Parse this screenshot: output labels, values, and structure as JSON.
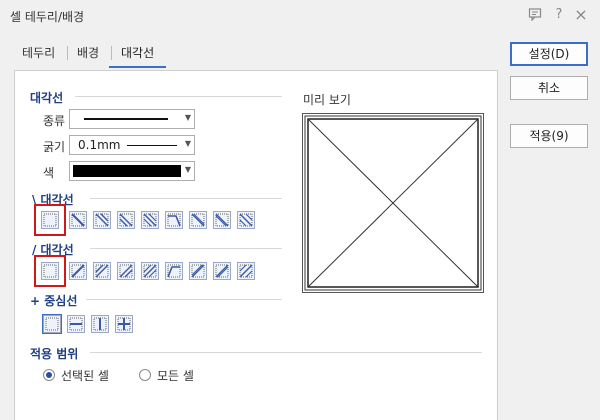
{
  "window": {
    "title": "셀 테두리/배경",
    "icons": [
      "chat-icon",
      "help-icon",
      "close-icon"
    ],
    "help_glyph": "?",
    "close_glyph": "×"
  },
  "tabs": [
    {
      "label": "테두리"
    },
    {
      "label": "배경"
    },
    {
      "label": "대각선",
      "active": true
    }
  ],
  "buttons": {
    "ok": "설정(D)",
    "cancel": "취소",
    "apply": "적용(9)"
  },
  "diagonal": {
    "section_title": "대각선",
    "type_label": "종류",
    "thickness_label": "굵기",
    "thickness_value": "0.1mm",
    "color_label": "색",
    "color_value": "#000000"
  },
  "backslash_group": {
    "title": "\\ 대각선",
    "count": 8
  },
  "slash_group": {
    "title": "/ 대각선",
    "count": 8
  },
  "center_group": {
    "title": "+ 중심선",
    "count": 4
  },
  "preview": {
    "label": "미리 보기"
  },
  "scope": {
    "title": "적용 범위",
    "options": [
      {
        "label": "선택된 셀",
        "checked": true
      },
      {
        "label": "모든 셀",
        "checked": false
      }
    ]
  },
  "colors": {
    "accent": "#3c6ec8",
    "section": "#1f3f86",
    "highlight": "#d01818",
    "icon_fill": "#3a5aa8"
  }
}
